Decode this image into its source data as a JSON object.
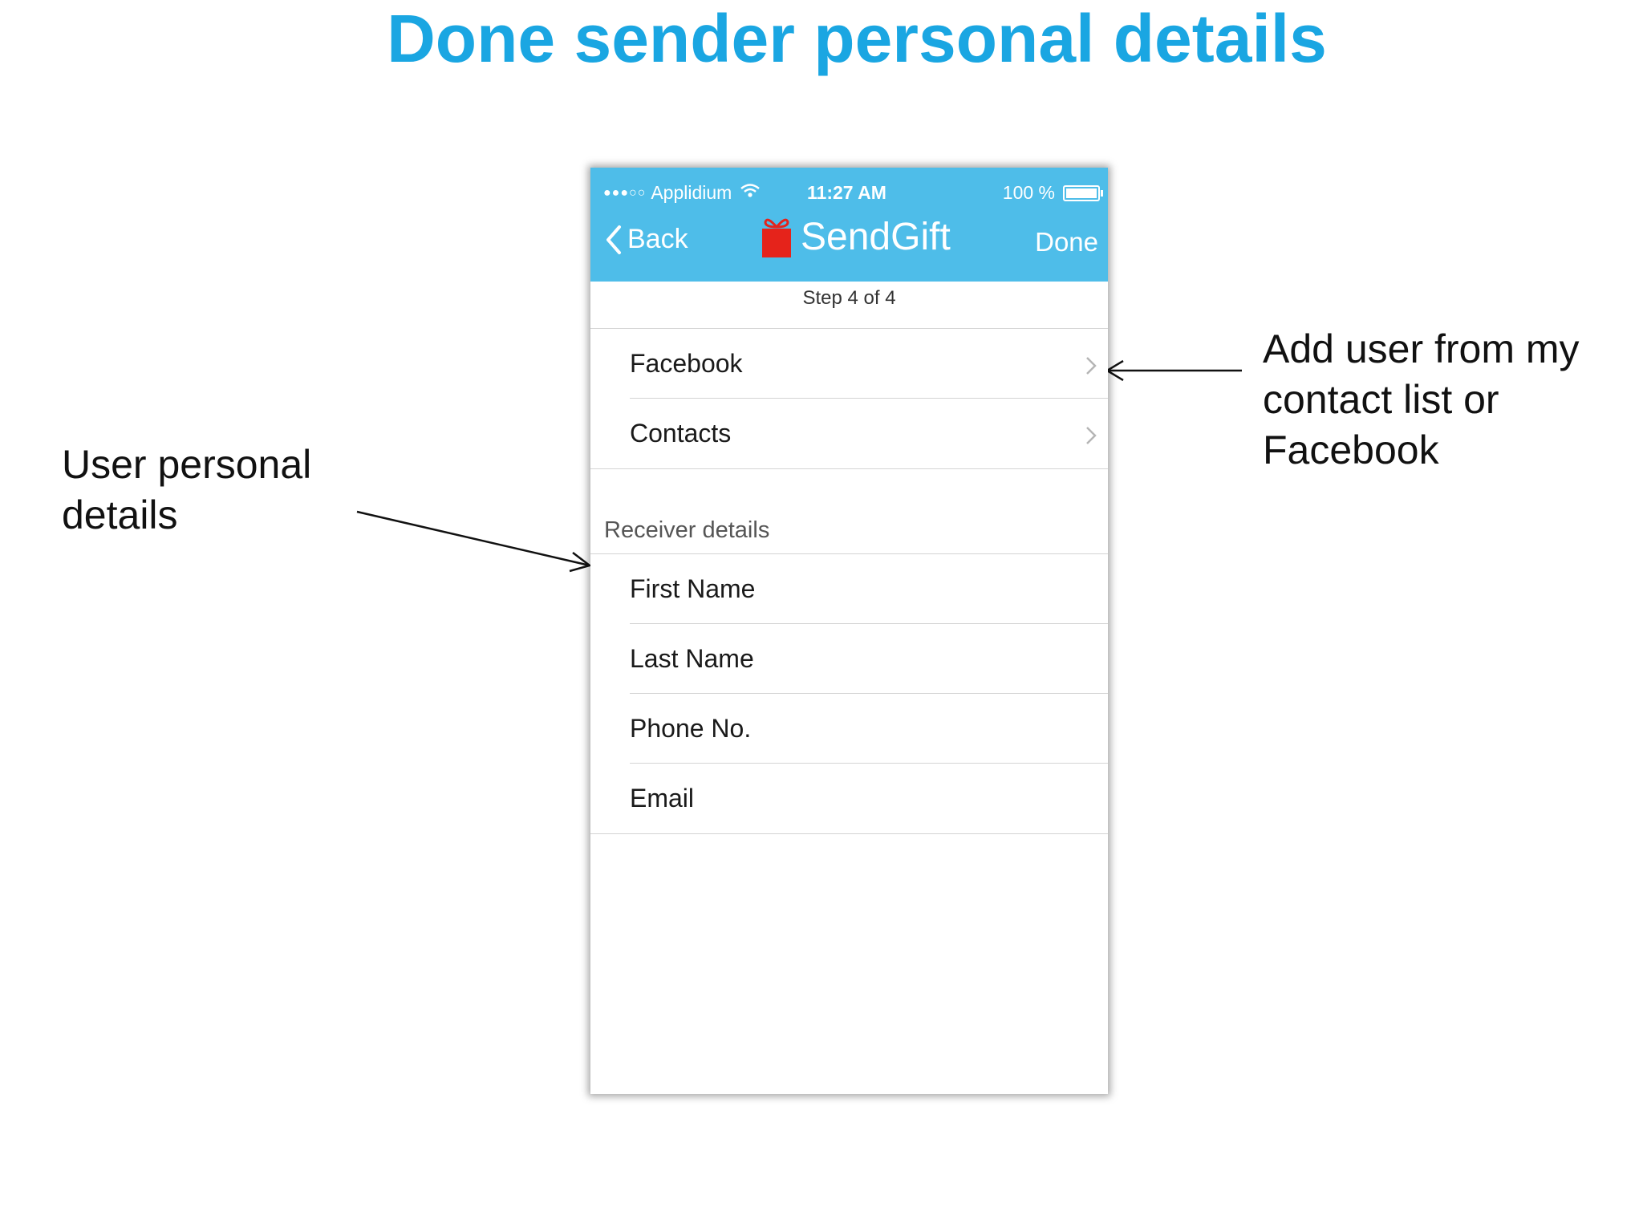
{
  "slide": {
    "title": "Done sender personal details"
  },
  "annotations": {
    "left": "User personal details",
    "right": "Add user from my contact list or Facebook"
  },
  "phone": {
    "status_bar": {
      "carrier": "Applidium",
      "time": "11:27 AM",
      "battery": "100 %"
    },
    "nav": {
      "back_label": "Back",
      "brand": "SendGift",
      "done_label": "Done",
      "logo_color": "#e5231b",
      "bar_color": "#4ebde9"
    },
    "step": "Step 4 of 4",
    "import_options": [
      {
        "label": "Facebook",
        "icon": "chevron-right-icon"
      },
      {
        "label": "Contacts",
        "icon": "chevron-right-icon"
      }
    ],
    "receiver_section_title": "Receiver details",
    "receiver_fields": [
      {
        "label": "First Name"
      },
      {
        "label": "Last Name"
      },
      {
        "label": "Phone No."
      },
      {
        "label": "Email"
      }
    ]
  },
  "colors": {
    "title": "#1aa6e2"
  }
}
